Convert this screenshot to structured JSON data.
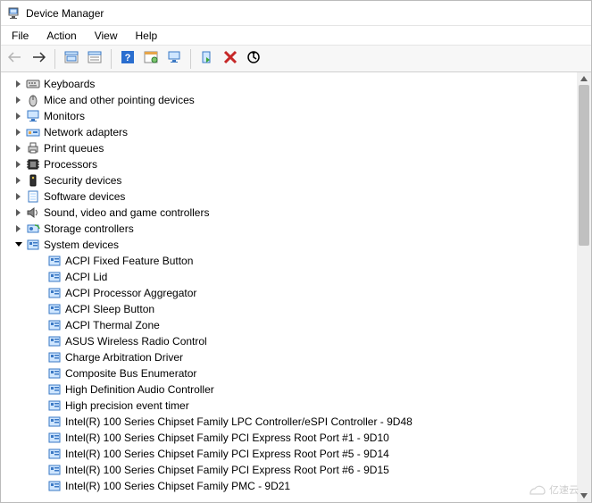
{
  "window": {
    "title": "Device Manager"
  },
  "menu": {
    "file": "File",
    "action": "Action",
    "view": "View",
    "help": "Help"
  },
  "tree": {
    "top": [
      {
        "id": "keyboards",
        "label": "Keyboards",
        "icon": "keyboard"
      },
      {
        "id": "mice",
        "label": "Mice and other pointing devices",
        "icon": "mouse"
      },
      {
        "id": "monitors",
        "label": "Monitors",
        "icon": "monitor"
      },
      {
        "id": "network",
        "label": "Network adapters",
        "icon": "netadapter"
      },
      {
        "id": "printq",
        "label": "Print queues",
        "icon": "printer"
      },
      {
        "id": "processors",
        "label": "Processors",
        "icon": "chip"
      },
      {
        "id": "security",
        "label": "Security devices",
        "icon": "secdev"
      },
      {
        "id": "software",
        "label": "Software devices",
        "icon": "softdev"
      },
      {
        "id": "sound",
        "label": "Sound, video and game controllers",
        "icon": "speaker"
      },
      {
        "id": "storagectl",
        "label": "Storage controllers",
        "icon": "storagectl"
      }
    ],
    "sys": {
      "id": "sysdevices",
      "label": "System devices",
      "icon": "sysdev",
      "children": [
        {
          "label": "ACPI Fixed Feature Button"
        },
        {
          "label": "ACPI Lid"
        },
        {
          "label": "ACPI Processor Aggregator"
        },
        {
          "label": "ACPI Sleep Button"
        },
        {
          "label": "ACPI Thermal Zone"
        },
        {
          "label": "ASUS Wireless Radio Control"
        },
        {
          "label": "Charge Arbitration Driver"
        },
        {
          "label": "Composite Bus Enumerator"
        },
        {
          "label": "High Definition Audio Controller"
        },
        {
          "label": "High precision event timer"
        },
        {
          "label": "Intel(R) 100 Series Chipset Family LPC Controller/eSPI Controller - 9D48"
        },
        {
          "label": "Intel(R) 100 Series Chipset Family PCI Express Root Port #1 - 9D10"
        },
        {
          "label": "Intel(R) 100 Series Chipset Family PCI Express Root Port #5 - 9D14"
        },
        {
          "label": "Intel(R) 100 Series Chipset Family PCI Express Root Port #6 - 9D15"
        },
        {
          "label": "Intel(R) 100 Series Chipset Family PMC - 9D21"
        }
      ]
    }
  },
  "watermark": "亿速云"
}
